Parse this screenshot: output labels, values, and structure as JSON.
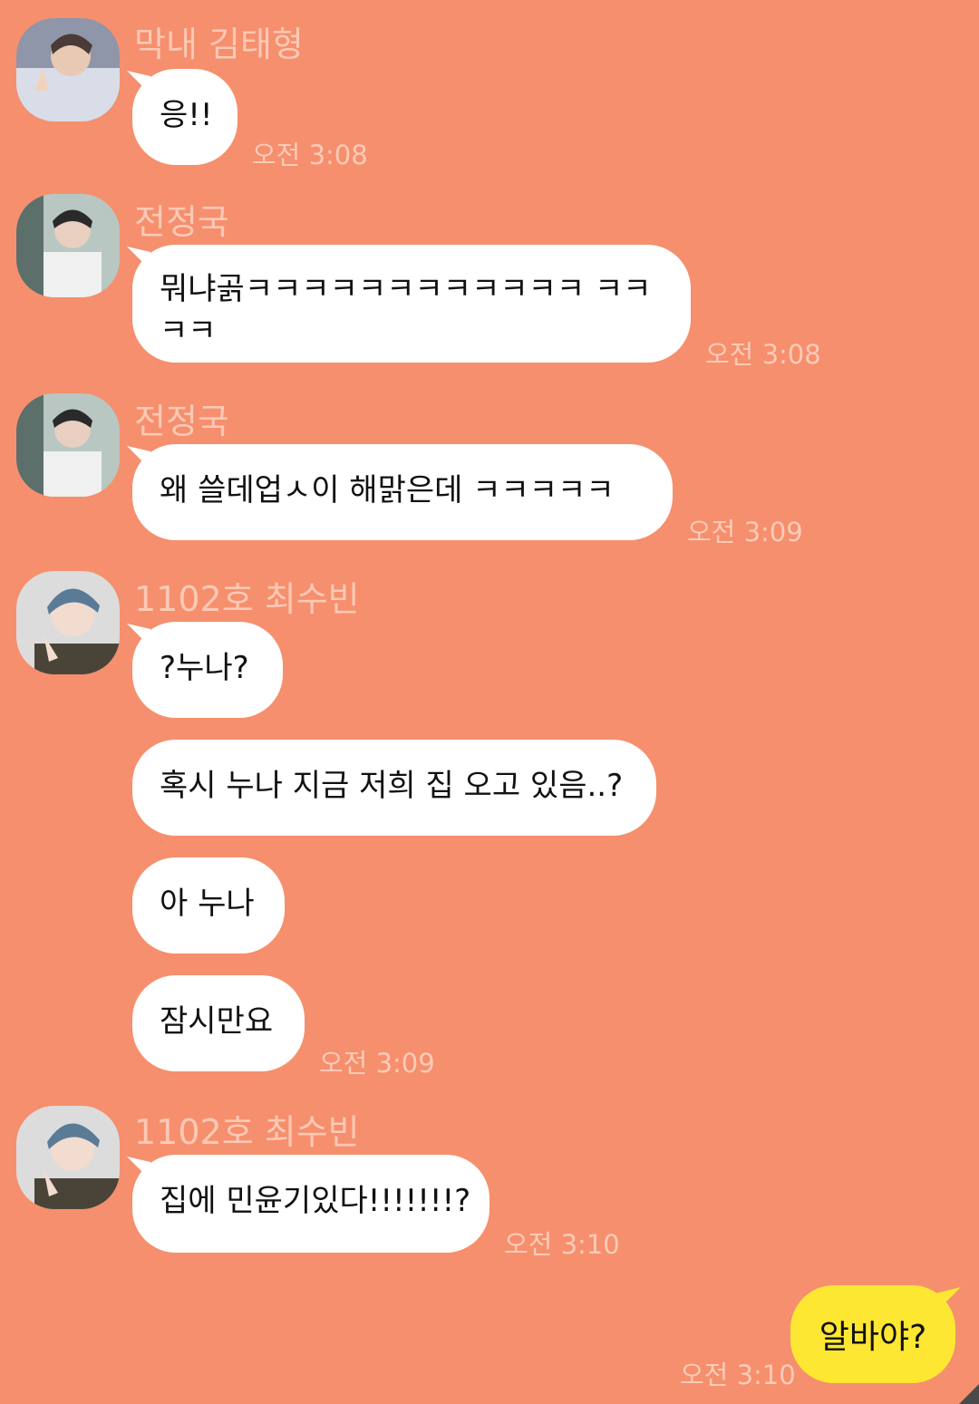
{
  "messages": [
    {
      "sender": "막내 김태형",
      "text": "응!!",
      "time": "오전 3:08"
    },
    {
      "sender": "전정국",
      "text": "뭐냐곩ㅋㅋㅋㅋㅋㅋㅋㅋㅋㅋㅋㅋ ㅋㅋㅋㅋ",
      "time": "오전 3:08"
    },
    {
      "sender": "전정국",
      "text": "왜 쓸데업ㅅ이 해맑은데 ㅋㅋㅋㅋㅋ",
      "time": "오전 3:09"
    },
    {
      "sender": "1102호 최수빈",
      "texts": [
        "?누나?",
        "혹시 누나 지금 저희 집 오고 있음..?",
        "아 누나",
        "잠시만요"
      ],
      "time": "오전 3:09"
    },
    {
      "sender": "1102호 최수빈",
      "text": "집에 민윤기있다!!!!!!!?",
      "time": "오전 3:10"
    }
  ],
  "my_message": {
    "text": "알바야?",
    "time": "오전 3:10"
  },
  "colors": {
    "background": "#F68F6D",
    "received_bubble": "#FFFFFF",
    "sent_bubble": "#FEE733"
  }
}
